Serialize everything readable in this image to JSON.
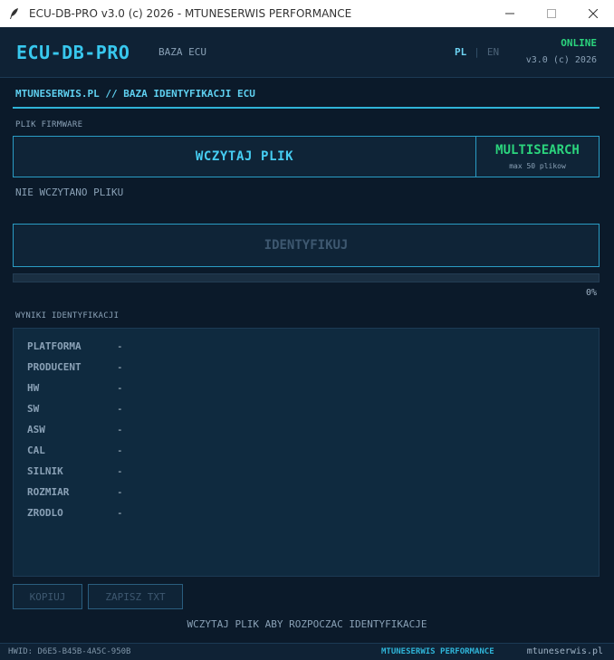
{
  "window": {
    "title": "ECU-DB-PRO v3.0 (c) 2026  -  MTUNESERWIS PERFORMANCE",
    "icons": [
      "feather-icon",
      "minimize-icon",
      "maximize-icon",
      "close-icon"
    ]
  },
  "header": {
    "brand": "ECU-DB-PRO",
    "subtitle": "BAZA ECU",
    "lang_pl": "PL",
    "lang_sep": "|",
    "lang_en": "EN",
    "status": "ONLINE",
    "version": "v3.0 (c) 2026"
  },
  "breadcrumb": "MTUNESERWIS.PL  //  BAZA IDENTYFIKACJI ECU",
  "firmware": {
    "section_label": "PLIK FIRMWARE",
    "load_label": "WCZYTAJ PLIK",
    "multisearch_label": "MULTISEARCH",
    "multisearch_sub": "max 50 plikow",
    "file_status": "NIE WCZYTANO PLIKU"
  },
  "identify": {
    "label": "IDENTYFIKUJ",
    "progress": 0,
    "progress_text": "0%"
  },
  "results": {
    "section_label": "WYNIKI IDENTYFIKACJI",
    "rows": [
      {
        "key": "PLATFORMA",
        "value": "-"
      },
      {
        "key": "PRODUCENT",
        "value": "-"
      },
      {
        "key": "HW",
        "value": "-"
      },
      {
        "key": "SW",
        "value": "-"
      },
      {
        "key": "ASW",
        "value": "-"
      },
      {
        "key": "CAL",
        "value": "-"
      },
      {
        "key": "SILNIK",
        "value": "-"
      },
      {
        "key": "ROZMIAR",
        "value": "-"
      },
      {
        "key": "ZRODLO",
        "value": "-"
      }
    ]
  },
  "actions": {
    "copy_label": "KOPIUJ",
    "save_label": "ZAPISZ TXT"
  },
  "hint": "WCZYTAJ PLIK ABY ROZPOCZAC IDENTYFIKACJE",
  "footer": {
    "hwid": "HWID: D6E5-B45B-4A5C-950B",
    "brand": "MTUNESERWIS PERFORMANCE",
    "site": "mtuneserwis.pl"
  },
  "colors": {
    "accent": "#38c8ee",
    "online": "#2bd47d",
    "background": "#0b1a2a"
  }
}
